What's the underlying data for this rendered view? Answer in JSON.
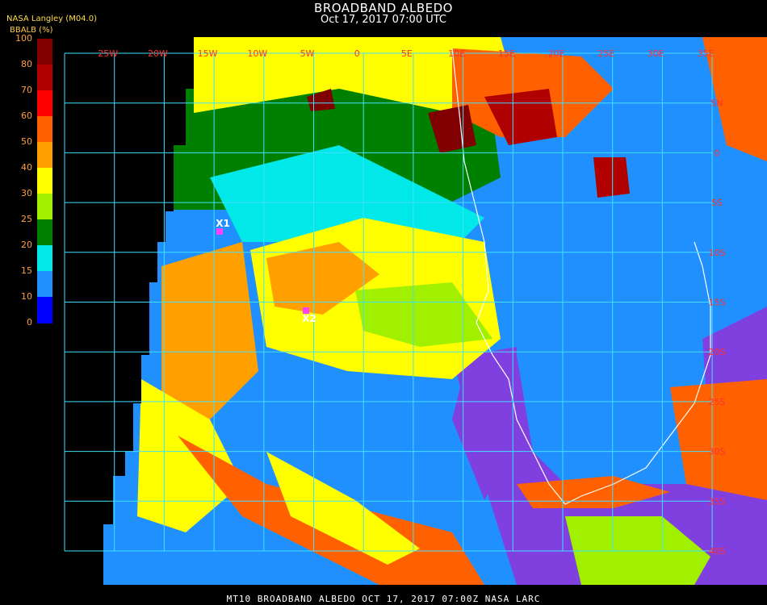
{
  "header": {
    "title": "BROADBAND ALBEDO",
    "subtitle": "Oct 17, 2017 07:00 UTC",
    "source": "NASA Langley (M04.0)",
    "units": "BBALB (%)"
  },
  "legend": {
    "ticks": [
      "100",
      "80",
      "70",
      "60",
      "50",
      "40",
      "30",
      "25",
      "20",
      "15",
      "10",
      "0"
    ],
    "colors": [
      "#800000",
      "#b00000",
      "#ff0000",
      "#ff6000",
      "#ffa000",
      "#ffff00",
      "#a0f000",
      "#008000",
      "#00e8e8",
      "#2090ff",
      "#0000ff",
      "#8040e0"
    ]
  },
  "grid": {
    "lon_labels": [
      "25W",
      "20W",
      "15W",
      "10W",
      "5W",
      "0",
      "5E",
      "10E",
      "15E",
      "20E",
      "25E",
      "30E",
      "35E"
    ],
    "lat_labels": [
      "5N",
      "0",
      "5S",
      "10S",
      "15S",
      "20S",
      "25S",
      "30S",
      "35S",
      "40S"
    ]
  },
  "markers": [
    {
      "label": "X1",
      "color": "#ff40ff"
    },
    {
      "label": "X2",
      "color": "#ff40ff"
    }
  ],
  "footer": "MT10  BROADBAND ALBEDO   OCT 17, 2017 07:00Z   NASA LARC"
}
